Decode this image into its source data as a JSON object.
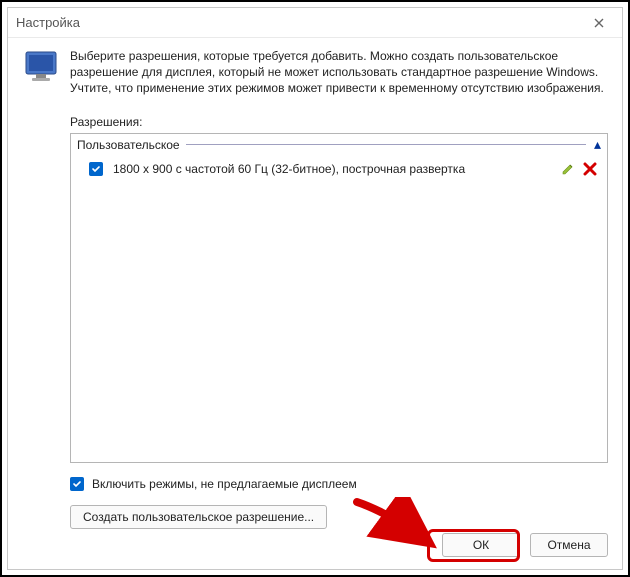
{
  "dialog": {
    "title": "Настройка",
    "description": "Выберите разрешения, которые требуется добавить. Можно создать пользовательское разрешение для дисплея, который не может использовать стандартное разрешение Windows. Учтите, что применение этих режимов может привести к временному отсутствию изображения.",
    "resolutions_label": "Разрешения:",
    "group": {
      "title": "Пользовательское"
    },
    "items": [
      {
        "checked": true,
        "label": "1800 x 900 с частотой 60 Гц (32-битное), построчная развертка"
      }
    ],
    "enable_unsupported": {
      "checked": true,
      "label": "Включить режимы, не предлагаемые дисплеем"
    },
    "create_button": "Создать пользовательское разрешение...",
    "ok_button": "ОК",
    "cancel_button": "Отмена"
  },
  "colors": {
    "accent": "#0066cc",
    "highlight": "#d40000"
  }
}
